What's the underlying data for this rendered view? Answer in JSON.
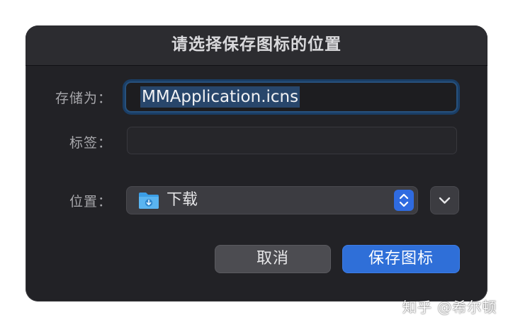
{
  "dialog": {
    "title": "请选择保存图标的位置",
    "save_as": {
      "label": "存储为：",
      "value": "MMApplication.icns"
    },
    "tags": {
      "label": "标签：",
      "value": ""
    },
    "location": {
      "label": "位置：",
      "selected": "下载",
      "icon": "downloads-folder-icon"
    },
    "buttons": {
      "cancel": "取消",
      "save": "保存图标"
    }
  },
  "watermark": "知乎 @希尔顿",
  "colors": {
    "dialog_bg": "#222226",
    "accent": "#2f6fd8",
    "focus_ring": "#27517d",
    "selection": "#28466b"
  }
}
